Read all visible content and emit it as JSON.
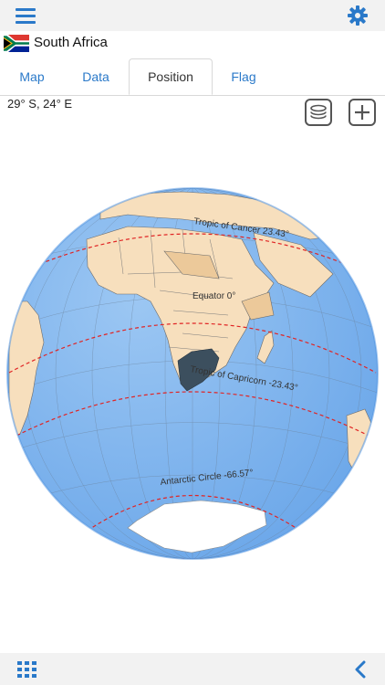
{
  "header": {
    "menu_icon": "hamburger-menu-icon",
    "settings_icon": "gear-icon",
    "accent_color": "#2a79c9"
  },
  "country": {
    "name": "South Africa",
    "flag_icon": "south-africa-flag-icon"
  },
  "tabs": [
    {
      "label": "Map",
      "active": false
    },
    {
      "label": "Data",
      "active": false
    },
    {
      "label": "Position",
      "active": true
    },
    {
      "label": "Flag",
      "active": false
    }
  ],
  "position": {
    "coordinates": "29° S, 24° E"
  },
  "map_tools": {
    "layers_icon": "layers-icon",
    "add_icon": "plus-icon"
  },
  "globe": {
    "labels": {
      "cancer": "Tropic of Cancer 23.43°",
      "equator": "Equator 0°",
      "capricorn": "Tropic of Capricorn -23.43°",
      "antarctic": "Antarctic Circle -66.57°"
    },
    "colors": {
      "ocean": "#82b6ee",
      "land": "#f7dfbd",
      "highlight": "#3c4f5e",
      "lines": "#e02525"
    }
  },
  "footer": {
    "grid_icon": "grid-icon",
    "back_icon": "chevron-left-icon"
  }
}
